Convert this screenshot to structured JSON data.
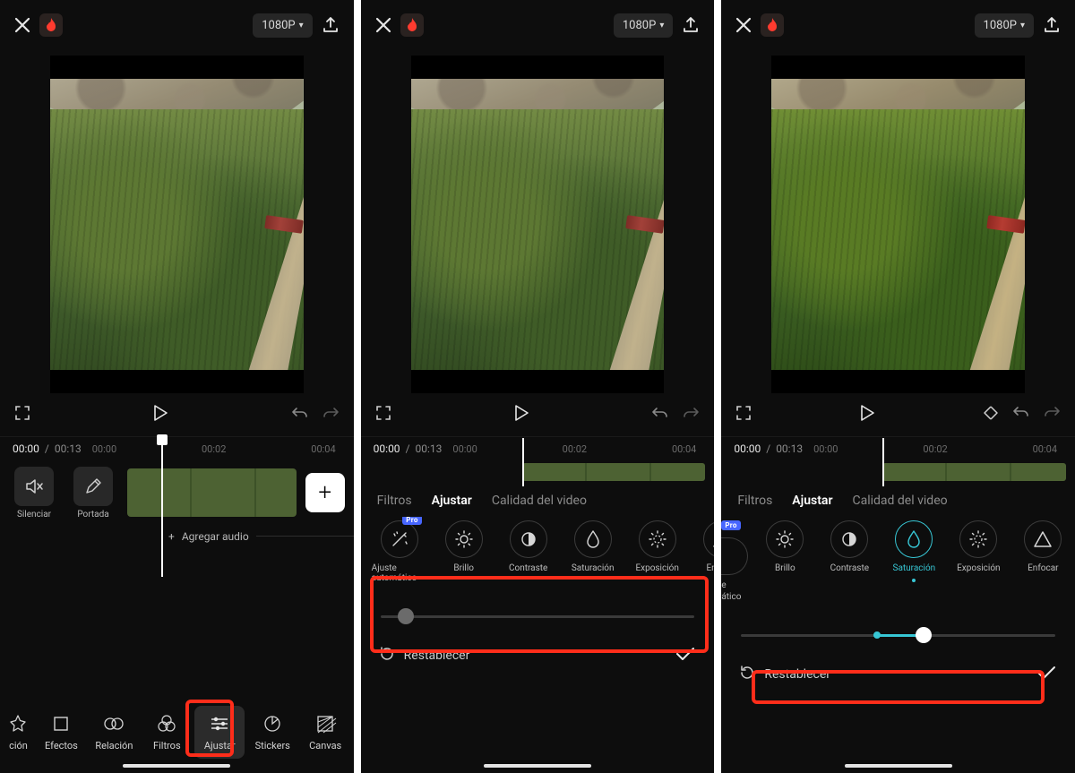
{
  "header": {
    "resolution_label": "1080P",
    "caret": "▾"
  },
  "time": {
    "current": "00:00",
    "sep": " / ",
    "total": "00:13"
  },
  "ticks": [
    "00:00",
    "00:02",
    "00:04"
  ],
  "panel1": {
    "mute_label": "Silenciar",
    "cover_label": "Portada",
    "add_audio_label": "Agregar audio",
    "nav": [
      {
        "label": "ción"
      },
      {
        "label": "Efectos"
      },
      {
        "label": "Relación"
      },
      {
        "label": "Filtros"
      },
      {
        "label": "Ajustar"
      },
      {
        "label": "Stickers"
      },
      {
        "label": "Canvas"
      }
    ]
  },
  "tabs": {
    "filtros": "Filtros",
    "ajustar": "Ajustar",
    "calidad": "Calidad del video"
  },
  "adjust_items": [
    {
      "label": "Ajuste automático",
      "icon": "wand",
      "pro": true
    },
    {
      "label": "Brillo",
      "icon": "sun"
    },
    {
      "label": "Contraste",
      "icon": "contrast"
    },
    {
      "label": "Saturación",
      "icon": "drop"
    },
    {
      "label": "Exposición",
      "icon": "exposure"
    },
    {
      "label": "Enfocar",
      "icon": "triangle"
    }
  ],
  "panel3": {
    "partial_label": "e",
    "partial_label2": "ático",
    "items": [
      {
        "label": "Brillo",
        "icon": "sun"
      },
      {
        "label": "Contraste",
        "icon": "contrast"
      },
      {
        "label": "Saturación",
        "icon": "drop",
        "selected": true
      },
      {
        "label": "Exposición",
        "icon": "exposure"
      },
      {
        "label": "Enfocar",
        "icon": "triangle"
      }
    ],
    "slider_percent": 58
  },
  "reset_label": "Restablecer",
  "icons": {
    "close": "✕",
    "flame": "🔥",
    "plus": "+"
  }
}
